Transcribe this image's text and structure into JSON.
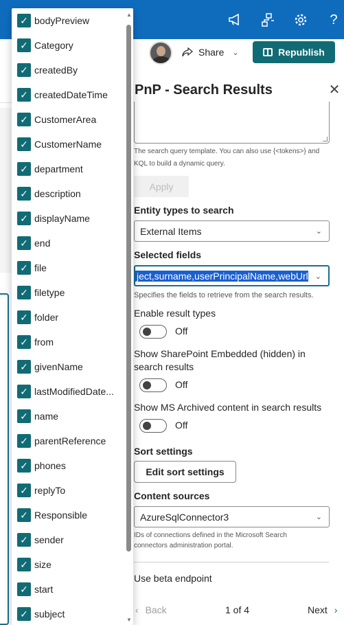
{
  "topbar": {
    "icons": [
      "megaphone-icon",
      "org-chart-icon",
      "gear-icon",
      "help-icon"
    ],
    "help_glyph": "?"
  },
  "command_bar": {
    "share_label": "Share",
    "republish_label": "Republish"
  },
  "pane": {
    "title": "PnP - Search Results",
    "query_help": "The search query template. You can also use {<tokens>} and KQL to build a dynamic query.",
    "apply_label": "Apply",
    "entity_label": "Entity types to search",
    "entity_value": "External Items",
    "fields_label": "Selected fields",
    "fields_value": "ject,surname,userPrincipalName,webUrl",
    "fields_help": "Specifies the fields to retrieve from the search results.",
    "result_types_label": "Enable result types",
    "result_types_state": "Off",
    "embedded_label": "Show SharePoint Embedded (hidden) in search results",
    "embedded_state": "Off",
    "archived_label": "Show MS Archived content in search results",
    "archived_state": "Off",
    "sort_label": "Sort settings",
    "sort_button": "Edit sort settings",
    "content_sources_label": "Content sources",
    "content_sources_value": "AzureSqlConnector3",
    "content_sources_help": "IDs of connections defined in the Microsoft Search connectors administration portal.",
    "beta_label": "Use beta endpoint",
    "pager": {
      "back": "Back",
      "page": "1 of 4",
      "next": "Next"
    }
  },
  "fields": [
    "bodyPreview",
    "Category",
    "createdBy",
    "createdDateTime",
    "CustomerArea",
    "CustomerName",
    "department",
    "description",
    "displayName",
    "end",
    "file",
    "filetype",
    "folder",
    "from",
    "givenName",
    "lastModifiedDate...",
    "name",
    "parentReference",
    "phones",
    "replyTo",
    "Responsible",
    "sender",
    "size",
    "start",
    "subject"
  ],
  "colors": {
    "suite_bar": "#0f6cbd",
    "accent": "#116b74",
    "selection": "#1a5fcf"
  }
}
